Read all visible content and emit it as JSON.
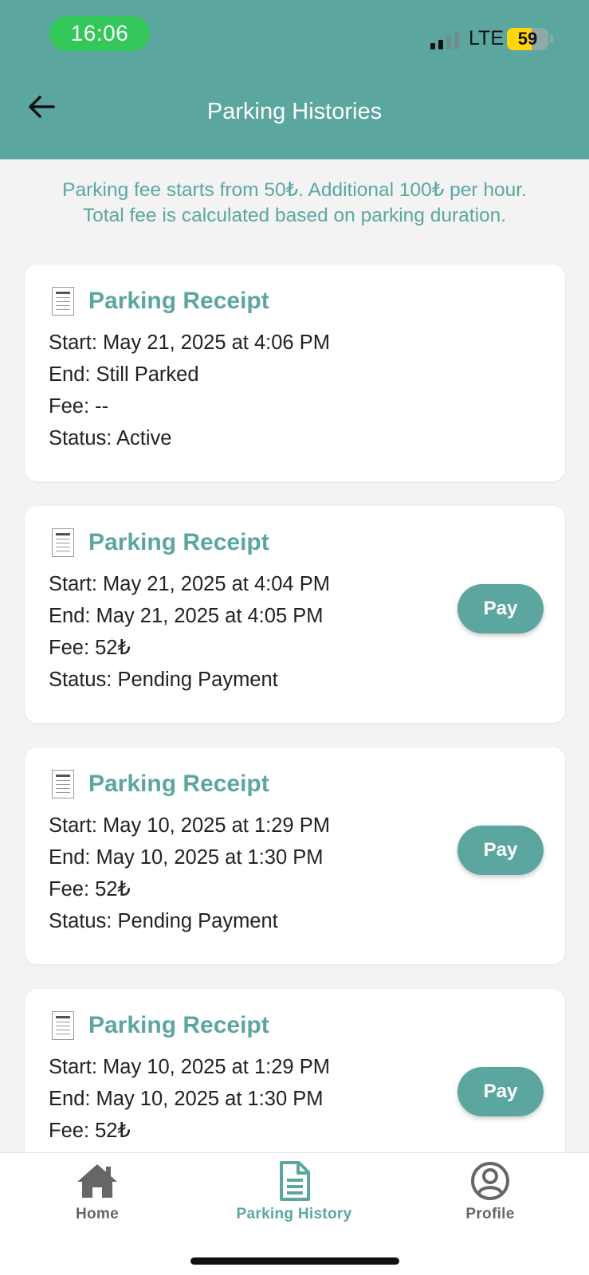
{
  "status_bar": {
    "time": "16:06",
    "network": "LTE",
    "battery": "59",
    "battery_color": "#ffd60a",
    "time_pill_color": "#34c759"
  },
  "header": {
    "title": "Parking Histories",
    "back_icon": "arrow-left-icon",
    "background_color": "#5ba7a0"
  },
  "info": {
    "line1": "Parking fee starts from 50₺. Additional 100₺ per hour.",
    "line2": "Total fee is calculated based on parking duration."
  },
  "receipts": [
    {
      "title": "Parking Receipt",
      "start": "Start: May 21, 2025 at 4:06 PM",
      "end": "End: Still Parked",
      "fee": "Fee: --",
      "status": "Status: Active"
    },
    {
      "title": "Parking Receipt",
      "start": "Start: May 21, 2025 at 4:04 PM",
      "end": "End: May 21, 2025 at 4:05 PM",
      "fee": "Fee: 52₺",
      "status": "Status: Pending Payment",
      "pay_label": "Pay"
    },
    {
      "title": "Parking Receipt",
      "start": "Start: May 10, 2025 at 1:29 PM",
      "end": "End: May 10, 2025 at 1:30 PM",
      "fee": "Fee: 52₺",
      "status": "Status: Pending Payment",
      "pay_label": "Pay"
    },
    {
      "title": "Parking Receipt",
      "start": "Start: May 10, 2025 at 1:29 PM",
      "end": "End: May 10, 2025 at 1:30 PM",
      "fee": "Fee: 52₺",
      "pay_label": "Pay"
    }
  ],
  "bottom_nav": {
    "items": [
      {
        "label": "Home",
        "icon": "home-icon",
        "active": false
      },
      {
        "label": "Parking History",
        "icon": "document-icon",
        "active": true
      },
      {
        "label": "Profile",
        "icon": "user-circle-icon",
        "active": false
      }
    ],
    "active_color": "#5ba7a0",
    "inactive_color": "#666666"
  }
}
